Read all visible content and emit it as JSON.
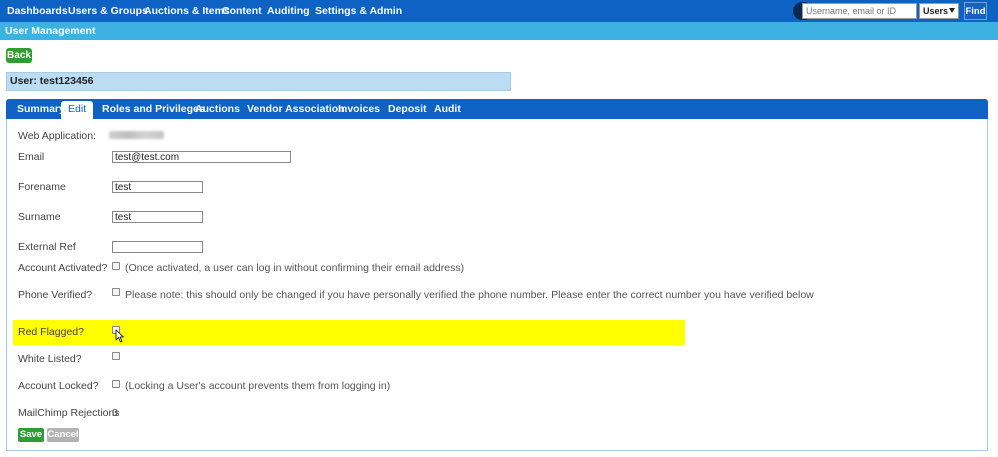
{
  "topnav": {
    "items": [
      "Dashboards",
      "Users & Groups",
      "Auctions & Items",
      "Content",
      "Auditing",
      "Settings & Admin"
    ],
    "search_placeholder": "Username, email or ID",
    "search_scope": "Users",
    "find_label": "Find"
  },
  "section_title": "User Management",
  "back_label": "Back",
  "user_header": "User: test123456",
  "tabs": [
    "Summary",
    "Edit",
    "Roles and Privileges",
    "Auctions",
    "Vendor Association",
    "Invoices",
    "Deposit",
    "Audit"
  ],
  "active_tab": "Edit",
  "form": {
    "web_application_label": "Web Application:",
    "email_label": "Email",
    "email_value": "test@test.com",
    "forename_label": "Forename",
    "forename_value": "test",
    "surname_label": "Surname",
    "surname_value": "test",
    "external_ref_label": "External Ref",
    "external_ref_value": "",
    "account_activated_label": "Account Activated?",
    "account_activated_note": "(Once activated, a user can log in without confirming their email address)",
    "phone_verified_label": "Phone Verified?",
    "phone_verified_note": "Please note: this should only be changed if you have personally verified the phone number. Please enter the correct number you have verified below",
    "red_flagged_label": "Red Flagged?",
    "white_listed_label": "White Listed?",
    "account_locked_label": "Account Locked?",
    "account_locked_note": "(Locking a User's account prevents them from logging in)",
    "mailchimp_label": "MailChimp Rejections",
    "mailchimp_value": "0"
  },
  "save_label": "Save",
  "cancel_label": "Cancel",
  "colors": {
    "nav_blue": "#0d62c4",
    "section_blue": "#3eb1e3",
    "green": "#2e9e30",
    "highlight": "#ffff00"
  }
}
